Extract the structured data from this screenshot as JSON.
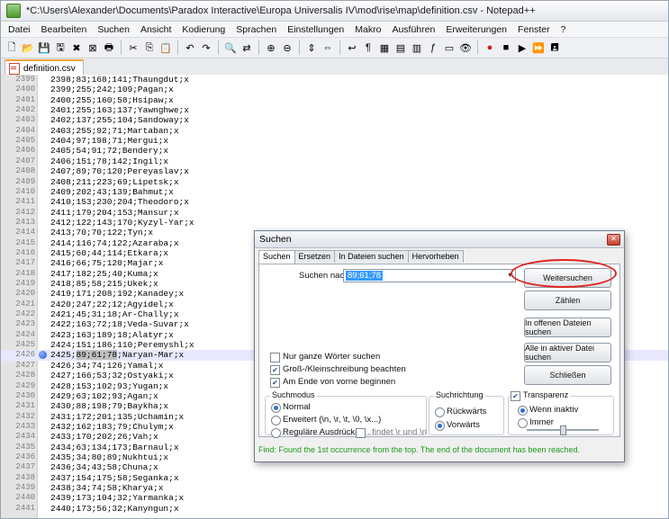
{
  "window": {
    "title": "*C:\\Users\\Alexander\\Documents\\Paradox Interactive\\Europa Universalis IV\\mod\\rise\\map\\definition.csv - Notepad++"
  },
  "menu": [
    "Datei",
    "Bearbeiten",
    "Suchen",
    "Ansicht",
    "Kodierung",
    "Sprachen",
    "Einstellungen",
    "Makro",
    "Ausführen",
    "Erweiterungen",
    "Fenster",
    "?"
  ],
  "tab": {
    "label": "definition.csv"
  },
  "editor": {
    "lines": [
      {
        "n": "2399",
        "t": "2398;83;168;141;Thaungdut;x"
      },
      {
        "n": "2400",
        "t": "2399;255;242;109;Pagan;x"
      },
      {
        "n": "2401",
        "t": "2400;255;160;58;Hsipaw;x"
      },
      {
        "n": "2402",
        "t": "2401;255;163;137;Yawnghwe;x"
      },
      {
        "n": "2403",
        "t": "2402;137;255;104;Sandoway;x"
      },
      {
        "n": "2404",
        "t": "2403;255;92;71;Martaban;x"
      },
      {
        "n": "2405",
        "t": "2404;97;198;71;Mergui;x"
      },
      {
        "n": "2406",
        "t": "2405;54;91;72;Bendery;x"
      },
      {
        "n": "2407",
        "t": "2406;151;78;142;Ingil;x"
      },
      {
        "n": "2408",
        "t": "2407;89;70;120;Pereyaslav;x"
      },
      {
        "n": "2409",
        "t": "2408;211;223;69;Lipetsk;x"
      },
      {
        "n": "2410",
        "t": "2409;202;43;139;Bahmut;x"
      },
      {
        "n": "2411",
        "t": "2410;153;230;204;Theodoro;x"
      },
      {
        "n": "2412",
        "t": "2411;179;204;153;Mansur;x"
      },
      {
        "n": "2413",
        "t": "2412;122;143;170;Kyzyl-Yar;x"
      },
      {
        "n": "2414",
        "t": "2413;70;70;122;Tyn;x"
      },
      {
        "n": "2415",
        "t": "2414;116;74;122;Azaraba;x"
      },
      {
        "n": "2416",
        "t": "2415;60;44;114;Etkara;x"
      },
      {
        "n": "2417",
        "t": "2416;66;75;120;Majar;x"
      },
      {
        "n": "2418",
        "t": "2417;182;25;40;Kuma;x"
      },
      {
        "n": "2419",
        "t": "2418;85;58;215;Ukek;x"
      },
      {
        "n": "2420",
        "t": "2419;171;208;192;Kanadey;x"
      },
      {
        "n": "2421",
        "t": "2420;247;22;12;Agyidel;x"
      },
      {
        "n": "2422",
        "t": "2421;45;31;18;Ar-Chally;x"
      },
      {
        "n": "2423",
        "t": "2422;163;72;18;Veda-Suvar;x"
      },
      {
        "n": "2424",
        "t": "2423;163;189;18;Alatyr;x"
      },
      {
        "n": "2425",
        "t": "2424;151;186;110;Peremyshl;x"
      },
      {
        "n": "2426",
        "t": "2425;89;61;78;Naryan-Mar;x"
      },
      {
        "n": "2427",
        "t": "2426;34;74;126;Yamal;x"
      },
      {
        "n": "2428",
        "t": "2427;166;53;32;Ostyaki;x"
      },
      {
        "n": "2429",
        "t": "2428;153;102;93;Yugan;x"
      },
      {
        "n": "2430",
        "t": "2429;63;102;93;Agan;x"
      },
      {
        "n": "2431",
        "t": "2430;88;198;79;Baykha;x"
      },
      {
        "n": "2432",
        "t": "2431;172;201;135;Uchamin;x"
      },
      {
        "n": "2433",
        "t": "2432;162;183;79;Chulym;x"
      },
      {
        "n": "2434",
        "t": "2433;170;202;26;Vah;x"
      },
      {
        "n": "2435",
        "t": "2434;63;134;173;Barnaul;x"
      },
      {
        "n": "2436",
        "t": "2435;34;80;89;Nukhtui;x"
      },
      {
        "n": "2437",
        "t": "2436;34;43;58;Chuna;x"
      },
      {
        "n": "2438",
        "t": "2437;154;175;58;Seganka;x"
      },
      {
        "n": "2439",
        "t": "2438;34;74;58;Kharya;x"
      },
      {
        "n": "2440",
        "t": "2439;173;104;32;Yarmanka;x"
      },
      {
        "n": "2441",
        "t": "2440;173;56;32;Kanyngun;x"
      }
    ],
    "current_line_index": 27,
    "selected_text": "89;61;78"
  },
  "dialog": {
    "title": "Suchen",
    "tabs": [
      "Suchen",
      "Ersetzen",
      "In Dateien suchen",
      "Hervorheben"
    ],
    "find_label": "Suchen nach:",
    "find_value": "89;61;78",
    "buttons": {
      "find_next": "Weitersuchen",
      "count": "Zählen",
      "find_all_open": "In offenen Dateien suchen",
      "find_all_current": "Alle in aktiver Datei suchen",
      "close": "Schließen"
    },
    "options": {
      "whole_word": "Nur ganze Wörter suchen",
      "match_case": "Groß-/Kleinschreibung beachten",
      "wrap": "Am Ende von vorne beginnen"
    },
    "search_mode": {
      "title": "Suchmodus",
      "normal": "Normal",
      "extended": "Erweitert (\\n, \\r, \\t, \\0, \\x...)",
      "regex": "Reguläre Ausdrücke",
      "dot_newline": ". findet \\r und \\n"
    },
    "direction": {
      "title": "Suchrichtung",
      "up": "Rückwärts",
      "down": "Vorwärts"
    },
    "transparency": {
      "title": "Transparenz",
      "on_lose_focus": "Wenn inaktiv",
      "always": "Immer",
      "level": 0.5
    },
    "status": "Find: Found the 1st occurrence from the top. The end of the document has been reached."
  }
}
